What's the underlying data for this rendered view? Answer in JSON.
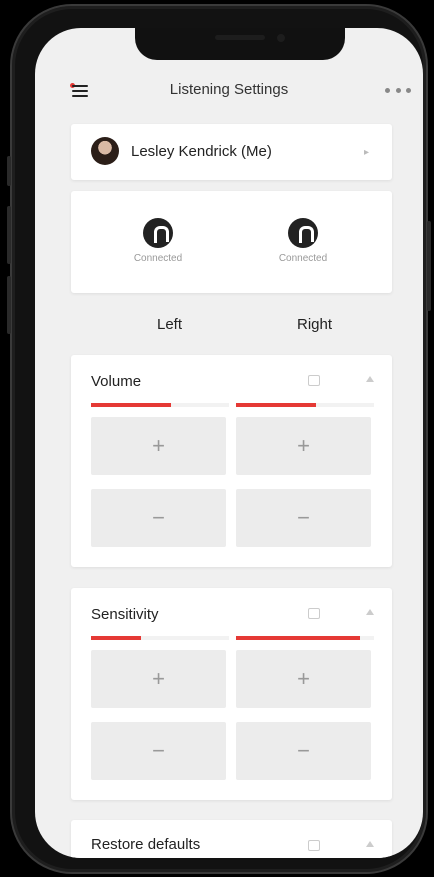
{
  "header": {
    "title": "Listening Settings",
    "menu_icon": "hamburger-menu-icon",
    "more_icon": "more-dots-icon"
  },
  "user": {
    "name": "Lesley Kendrick (Me)",
    "avatar_icon": "avatar"
  },
  "devices": {
    "left": {
      "status": "Connected"
    },
    "right": {
      "status": "Connected"
    }
  },
  "sides": {
    "left": "Left",
    "right": "Right"
  },
  "volume": {
    "title": "Volume",
    "left_level": 0.58,
    "right_level": 0.58,
    "increase": "+",
    "decrease": "−"
  },
  "sensitivity": {
    "title": "Sensitivity",
    "left_level": 0.36,
    "right_level": 0.9,
    "increase": "+",
    "decrease": "−"
  },
  "restore": {
    "title": "Restore defaults"
  },
  "colors": {
    "accent": "#e53935",
    "background": "#f0f0f0",
    "card": "#ffffff"
  }
}
